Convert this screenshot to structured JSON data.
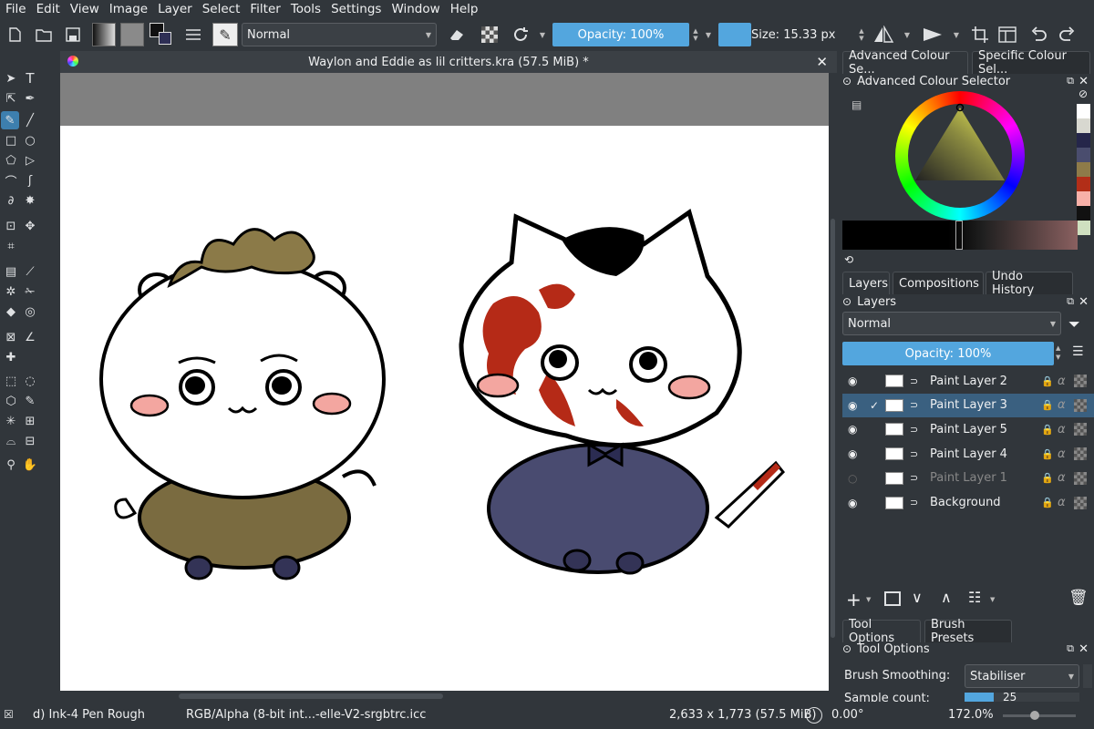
{
  "menu": [
    "File",
    "Edit",
    "View",
    "Image",
    "Layer",
    "Select",
    "Filter",
    "Tools",
    "Settings",
    "Window",
    "Help"
  ],
  "toolbar": {
    "blend_mode": "Normal",
    "opacity_label": "Opacity: 100%",
    "size_label": "Size: 15.33 px"
  },
  "document": {
    "title": "Waylon and Eddie as lil critters.kra (57.5 MiB) *"
  },
  "right_panel": {
    "top_tabs": [
      "Advanced Colour Se...",
      "Specific Colour Sel..."
    ],
    "color_selector_title": "Advanced Colour Selector",
    "mid_tabs": [
      "Layers",
      "Compositions",
      "Undo History"
    ],
    "layers_title": "Layers",
    "layer_blend": "Normal",
    "layer_opacity": "Opacity:  100%",
    "layers": [
      {
        "name": "Paint Layer 2",
        "visible": true,
        "selected": false
      },
      {
        "name": "Paint Layer 3",
        "visible": true,
        "selected": true
      },
      {
        "name": "Paint Layer 5",
        "visible": true,
        "selected": false
      },
      {
        "name": "Paint Layer 4",
        "visible": true,
        "selected": false
      },
      {
        "name": "Paint Layer 1",
        "visible": false,
        "selected": false
      },
      {
        "name": "Background",
        "visible": true,
        "selected": false
      }
    ],
    "bottom_tabs": [
      "Tool Options",
      "Brush Presets"
    ],
    "tool_options_title": "Tool Options",
    "brush_smoothing_label": "Brush Smoothing:",
    "brush_smoothing_value": "Stabiliser",
    "sample_count_label": "Sample count:",
    "sample_count_value": "25"
  },
  "status": {
    "brush": "d) Ink-4 Pen Rough",
    "color_space": "RGB/Alpha (8-bit int...-elle-V2-srgbtrc.icc",
    "dimensions": "2,633 x 1,773 (57.5 MiB)",
    "rotation": "0.00°",
    "zoom": "172.0%"
  },
  "colors": {
    "accent": "#53a6de",
    "bg": "#31363b",
    "swatches": [
      "#ffffff",
      "#d8d8d0",
      "#25264a",
      "#4a4d6e",
      "#8e7b49",
      "#b22e18",
      "#f8b0a8",
      "#111111",
      "#cfe0c0"
    ]
  }
}
